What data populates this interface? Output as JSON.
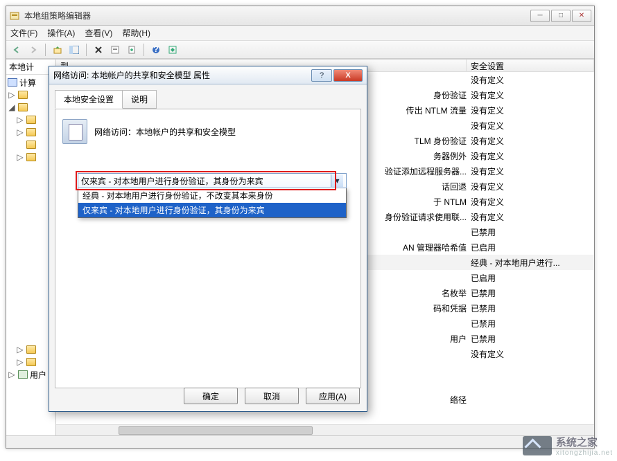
{
  "window": {
    "title": "本地组策略编辑器"
  },
  "menubar": {
    "file": "文件(F)",
    "action": "操作(A)",
    "view": "查看(V)",
    "help": "帮助(H)"
  },
  "tree": {
    "root": "本地计",
    "computer": "计算",
    "user": "用户"
  },
  "columns": {
    "policy_visible": "型",
    "setting": "安全设置"
  },
  "rows": [
    {
      "policy": "",
      "setting": "没有定义"
    },
    {
      "policy": "身份验证",
      "setting": "没有定义"
    },
    {
      "policy": "传出 NTLM 流量",
      "setting": "没有定义"
    },
    {
      "policy": "",
      "setting": "没有定义"
    },
    {
      "policy": "TLM 身份验证",
      "setting": "没有定义"
    },
    {
      "policy": "务器例外",
      "setting": "没有定义"
    },
    {
      "policy": "验证添加远程服务器...",
      "setting": "没有定义"
    },
    {
      "policy": "话回退",
      "setting": "没有定义"
    },
    {
      "policy": "于 NTLM",
      "setting": "没有定义"
    },
    {
      "policy": "身份验证请求使用联...",
      "setting": "没有定义"
    },
    {
      "policy": "",
      "setting": "已禁用"
    },
    {
      "policy": "AN 管理器哈希值",
      "setting": "已启用"
    },
    {
      "policy": "",
      "setting": "经典 - 对本地用户进行...",
      "sel": true
    },
    {
      "policy": "",
      "setting": "已启用"
    },
    {
      "policy": "名枚举",
      "setting": "已禁用"
    },
    {
      "policy": "码和凭据",
      "setting": "已禁用"
    },
    {
      "policy": "",
      "setting": "已禁用"
    },
    {
      "policy": "用户",
      "setting": "已禁用"
    },
    {
      "policy": "",
      "setting": "没有定义"
    },
    {
      "policy": "",
      "setting": ""
    },
    {
      "policy": "",
      "setting": ""
    },
    {
      "policy": "络径",
      "setting": ""
    }
  ],
  "dialog": {
    "title": "网络访问: 本地帐户的共享和安全模型 属性",
    "tabs": {
      "local": "本地安全设置",
      "explain": "说明"
    },
    "policy_name": "网络访问：本地帐户的共享和安全模型",
    "combo_selected": "仅来宾 - 对本地用户进行身份验证，其身份为来宾",
    "options": [
      "经典 - 对本地用户进行身份验证，不改变其本来身份",
      "仅来宾 - 对本地用户进行身份验证，其身份为来宾"
    ],
    "buttons": {
      "ok": "确定",
      "cancel": "取消",
      "apply": "应用(A)"
    }
  },
  "watermark": {
    "name": "系统之家",
    "sub": "xitongzhijia.net"
  }
}
